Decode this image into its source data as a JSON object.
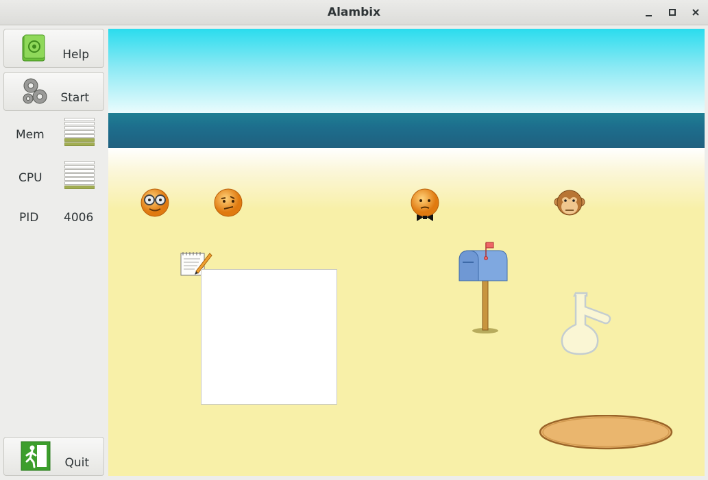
{
  "window": {
    "title": "Alambix",
    "minimize_glyph": "▁",
    "maximize_glyph": "□",
    "close_glyph": "✕"
  },
  "sidebar": {
    "help_label": "Help",
    "start_label": "Start",
    "quit_label": "Quit",
    "mem_label": "Mem",
    "cpu_label": "CPU",
    "pid_label": "PID",
    "pid_value": "4006",
    "mem_level_bars": 2,
    "cpu_level_bars": 1,
    "meter_total_bars": 7
  },
  "icons": {
    "help": "help-book-icon",
    "start": "gears-icon",
    "quit": "exit-door-icon",
    "agents": [
      "nerd-smiley-icon",
      "thinking-smiley-icon",
      "bowtie-smiley-icon",
      "monkey-icon"
    ],
    "objects": [
      "notepad-icon",
      "mailbox-icon",
      "flask-icon",
      "dish-icon"
    ]
  },
  "colors": {
    "meter_on": "#a2ae52",
    "sand": "#f8f0a8",
    "sea": "#1e6f8d",
    "sky": "#2adcee"
  }
}
